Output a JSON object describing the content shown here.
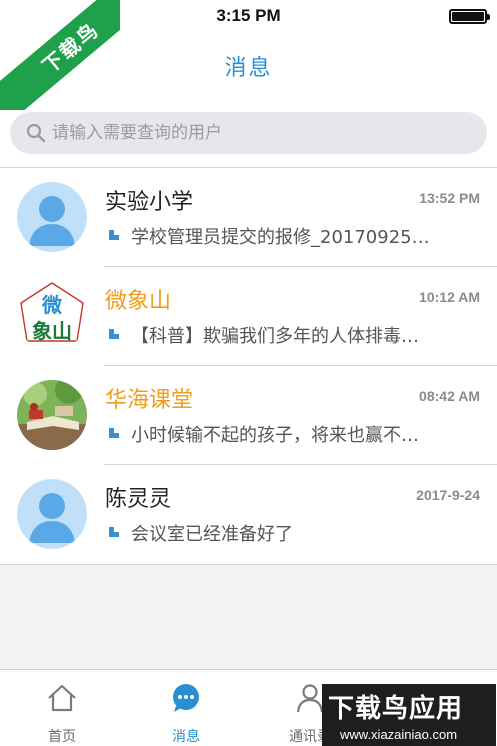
{
  "status": {
    "time": "3:15 PM"
  },
  "nav": {
    "title": "消息"
  },
  "search": {
    "placeholder": "请输入需要查询的用户"
  },
  "conversations": [
    {
      "name": "实验小学",
      "time": "13:52 PM",
      "preview": "学校管理员提交的报修_20170925…",
      "name_color": "#222222",
      "avatar": "default-avatar"
    },
    {
      "name": "微象山",
      "time": "10:12 AM",
      "preview": "【科普】欺骗我们多年的人体排毒…",
      "name_color": "#f39c1a",
      "avatar": "logo-avatar",
      "avatar_text": [
        "微",
        "象山"
      ]
    },
    {
      "name": "华海课堂",
      "time": "08:42 AM",
      "preview": "小时候输不起的孩子，将来也赢不…",
      "name_color": "#f39c1a",
      "avatar": "photo-avatar"
    },
    {
      "name": "陈灵灵",
      "time": "2017-9-24",
      "preview": "会议室已经准备好了",
      "name_color": "#222222",
      "avatar": "default-avatar"
    }
  ],
  "tabs": [
    {
      "label": "首页",
      "icon": "home-icon",
      "active": false
    },
    {
      "label": "消息",
      "icon": "chat-icon",
      "active": true
    },
    {
      "label": "通讯录",
      "icon": "contacts-icon",
      "active": false
    }
  ],
  "watermarks": {
    "corner_badge": "下载鸟",
    "brand": "下载鸟应用",
    "url": "www.xiazainiao.com"
  },
  "colors": {
    "accent": "#2a8fd0",
    "highlight_name": "#f39c1a",
    "badge_green": "#1fa04a"
  }
}
